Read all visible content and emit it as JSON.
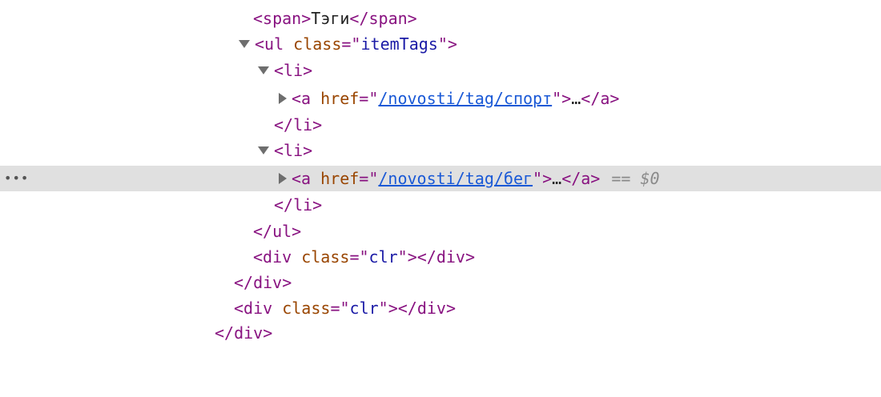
{
  "elements_tree": {
    "rows": [
      {
        "open": "<span>",
        "text": "Тэги",
        "close": "</span>"
      },
      {
        "tag_open": "<ul ",
        "attr_name": "class",
        "eq": "=\"",
        "attr_value": "itemTags",
        "quote_close": "\">"
      },
      {
        "tag": "<li>"
      },
      {
        "tag_open": "<a ",
        "attr_name": "href",
        "eq": "=\"",
        "href": "/novosti/tag/спорт",
        "quote_close": "\">",
        "ellipsis": "…",
        "close": "</a>"
      },
      {
        "tag": "</li>"
      },
      {
        "tag": "<li>"
      },
      {
        "tag_open": "<a ",
        "attr_name": "href",
        "eq": "=\"",
        "href": "/novosti/tag/бег",
        "quote_close": "\">",
        "ellipsis": "…",
        "close": "</a>",
        "selected_marker": "== $0"
      },
      {
        "tag": "</li>"
      },
      {
        "tag": "</ul>"
      },
      {
        "tag_open": "<div ",
        "attr_name": "class",
        "eq": "=\"",
        "attr_value": "clr",
        "quote_close": "\">",
        "close": "</div>"
      },
      {
        "tag": "</div>"
      },
      {
        "tag_open": "<div ",
        "attr_name": "class",
        "eq": "=\"",
        "attr_value": "clr",
        "quote_close": "\">",
        "close": "</div>"
      },
      {
        "tag": "</div>"
      }
    ],
    "row_menu_dots": "•••",
    "colors": {
      "tag": "#881280",
      "attr_name": "#994500",
      "attr_value": "#1a1aa6",
      "link": "#1a59d6",
      "selected_row_bg": "#e0e0e0",
      "marker": "#8a8a8a"
    },
    "icons": {
      "expanded": "triangle-down-icon",
      "collapsed": "triangle-right-icon",
      "menu": "more-dots-icon"
    }
  }
}
